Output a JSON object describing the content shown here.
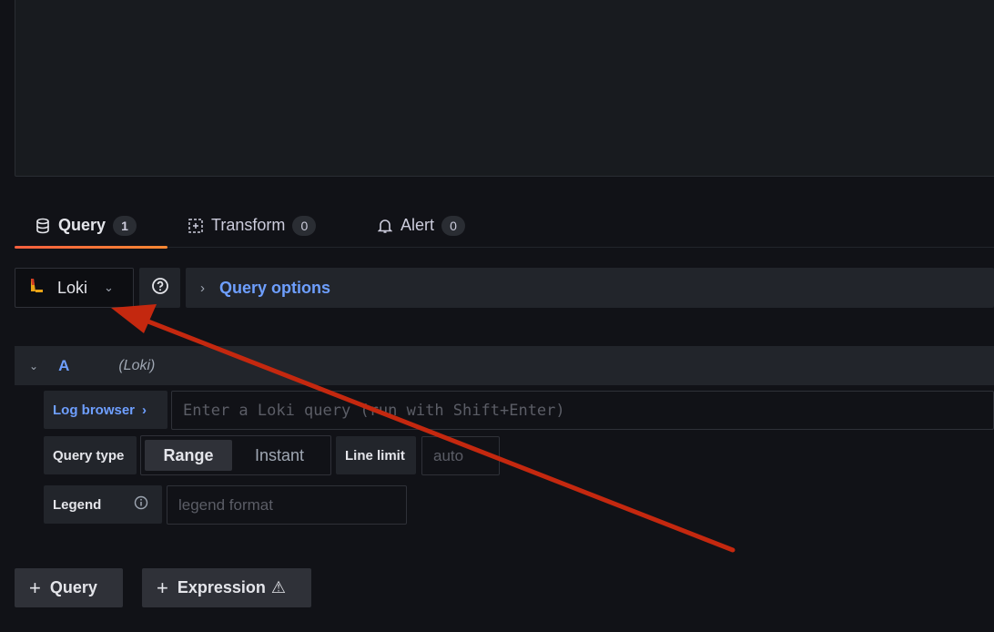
{
  "tabs": [
    {
      "label": "Query",
      "count": "1",
      "icon": "database-icon"
    },
    {
      "label": "Transform",
      "count": "0",
      "icon": "transform-icon"
    },
    {
      "label": "Alert",
      "count": "0",
      "icon": "bell-icon"
    }
  ],
  "datasource": {
    "name": "Loki",
    "icon": "loki-logo"
  },
  "query_options": {
    "label": "Query options"
  },
  "query_row": {
    "ref_id": "A",
    "datasource_label": "(Loki)"
  },
  "log_browser": {
    "label": "Log browser",
    "chevron": "›"
  },
  "query_input": {
    "placeholder": "Enter a Loki query (run with Shift+Enter)"
  },
  "query_type": {
    "label": "Query type",
    "options": [
      "Range",
      "Instant"
    ],
    "selected": "Range"
  },
  "line_limit": {
    "label": "Line limit",
    "placeholder": "auto"
  },
  "legend": {
    "label": "Legend",
    "placeholder": "legend format"
  },
  "buttons": {
    "add_query": "Query",
    "add_expression": "Expression",
    "expression_warning": "⚠"
  },
  "colors": {
    "accent": "#6e9fff",
    "active_tab": "#ff8833",
    "annotation_arrow": "#c4280f"
  }
}
